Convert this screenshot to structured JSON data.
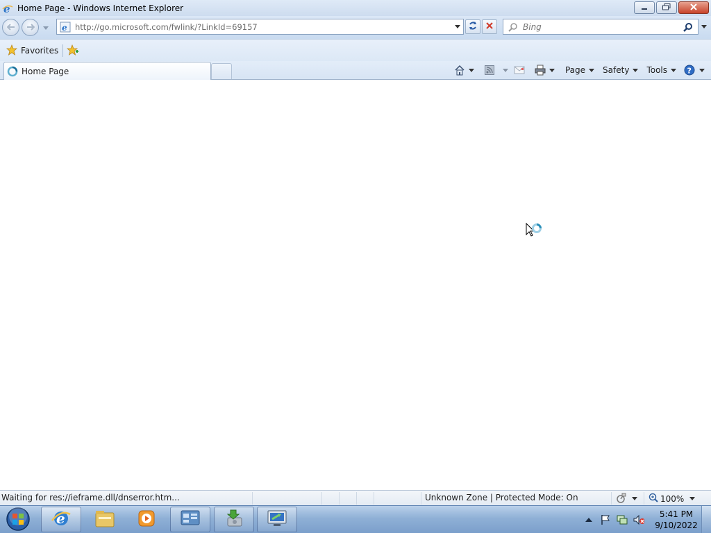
{
  "window": {
    "title": "Home Page - Windows Internet Explorer",
    "controls": [
      "minimize-icon",
      "restore-icon",
      "close-icon"
    ]
  },
  "navigation": {
    "address_url": "http://go.microsoft.com/fwlink/?LinkId=69157",
    "search_placeholder": "Bing"
  },
  "favorites_bar": {
    "favorites_label": "Favorites"
  },
  "tabs": [
    {
      "label": "Home Page",
      "active": true,
      "loading": true
    }
  ],
  "command_bar": {
    "page_label": "Page",
    "safety_label": "Safety",
    "tools_label": "Tools"
  },
  "status_bar": {
    "status_text": "Waiting for res://ieframe.dll/dnserror.htm...",
    "zone_text": "Unknown Zone | Protected Mode: On",
    "zoom_text": "100%"
  },
  "taskbar": {
    "apps": [
      "internet-explorer-icon",
      "windows-explorer-icon",
      "media-player-icon",
      "control-panel-icon",
      "installer-icon",
      "remote-desktop-icon"
    ],
    "clock_time": "5:41 PM",
    "clock_date": "9/10/2022"
  }
}
